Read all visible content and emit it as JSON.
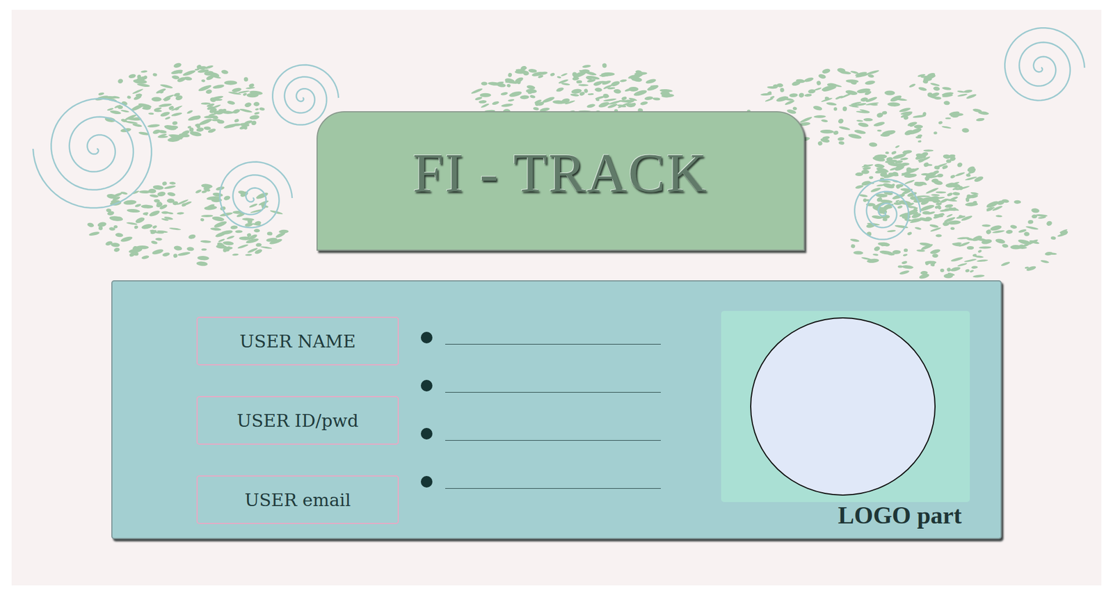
{
  "header": {
    "title": "FI - TRACK"
  },
  "fields": [
    {
      "label": "USER NAME"
    },
    {
      "label": "USER ID/pwd"
    },
    {
      "label": "USER email"
    }
  ],
  "entries": [
    {
      "value": ""
    },
    {
      "value": ""
    },
    {
      "value": ""
    },
    {
      "value": ""
    }
  ],
  "logo": {
    "caption": "LOGO part"
  }
}
